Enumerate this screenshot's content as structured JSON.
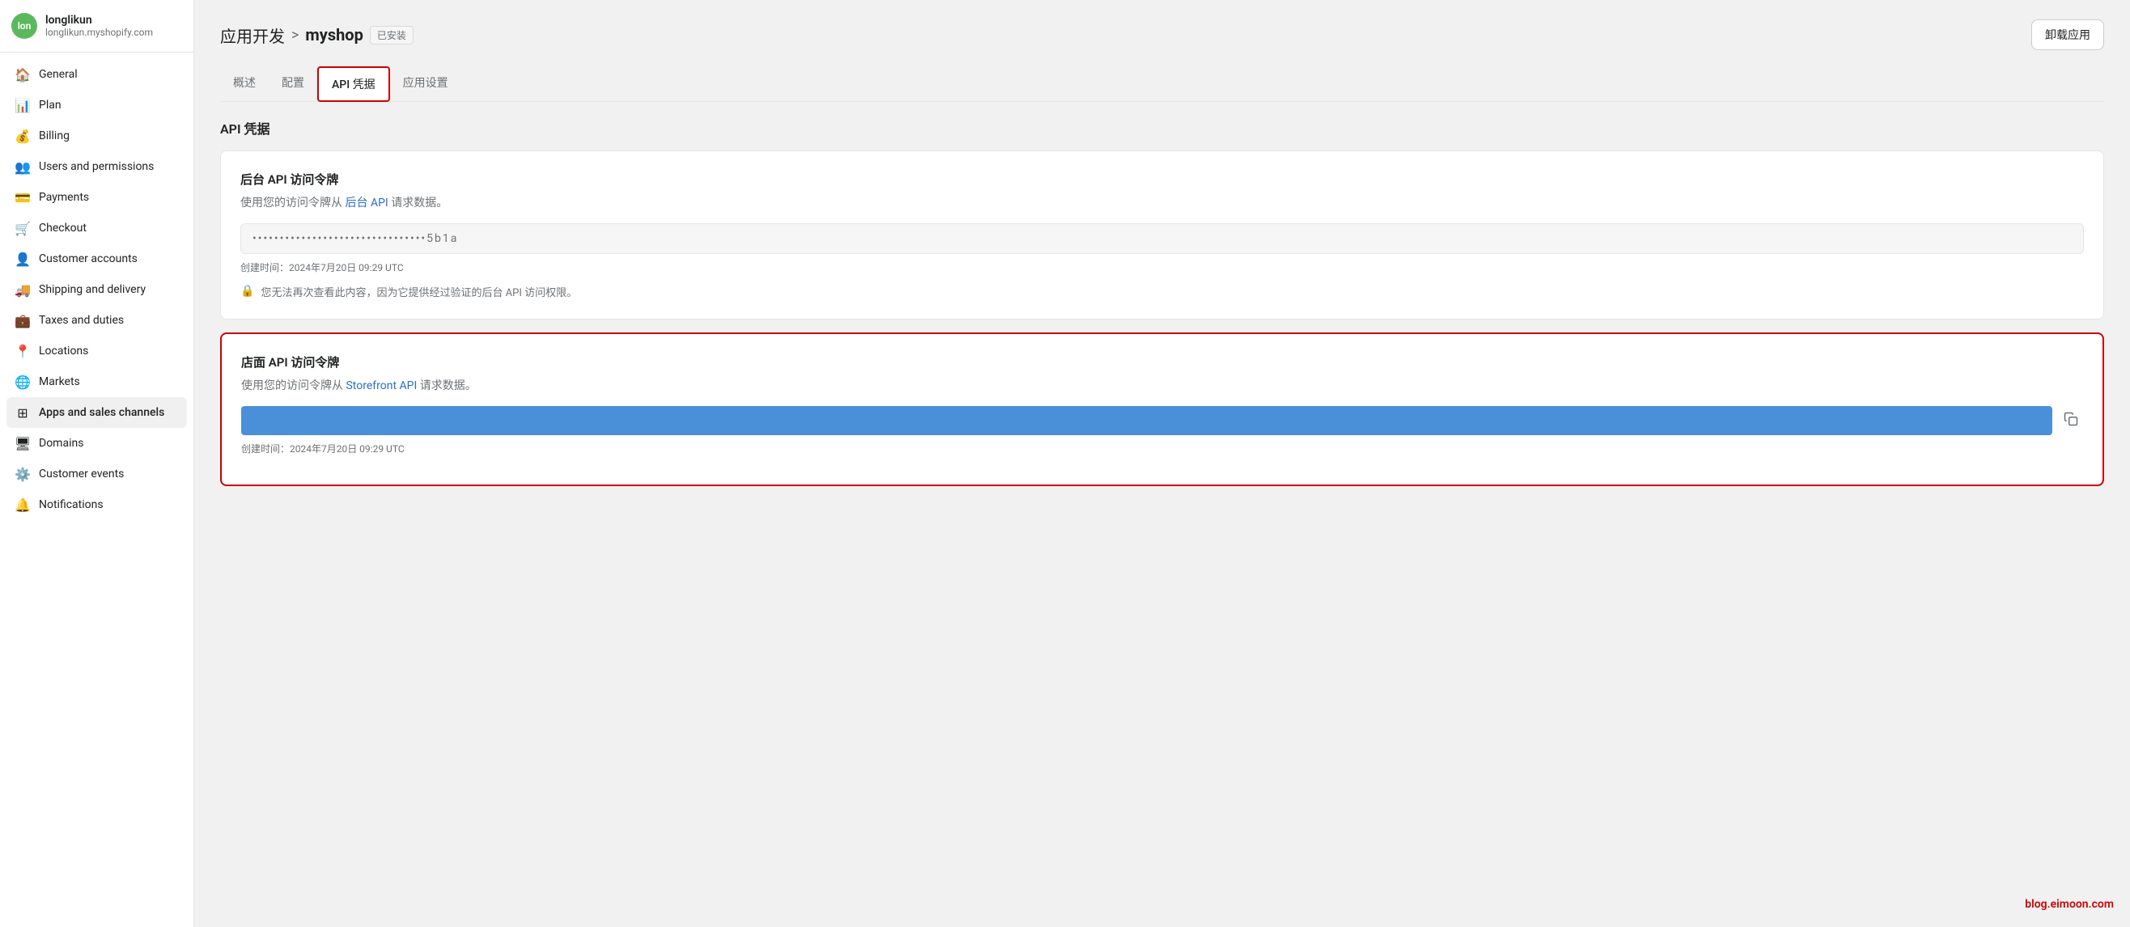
{
  "sidebar": {
    "profile": {
      "initials": "lon",
      "username": "longlikun",
      "domain": "longlikun.myshopify.com"
    },
    "items": [
      {
        "id": "general",
        "label": "General",
        "icon": "🏠",
        "active": false
      },
      {
        "id": "plan",
        "label": "Plan",
        "icon": "📊",
        "active": false
      },
      {
        "id": "billing",
        "label": "Billing",
        "icon": "💰",
        "active": false
      },
      {
        "id": "users",
        "label": "Users and permissions",
        "icon": "👥",
        "active": false
      },
      {
        "id": "payments",
        "label": "Payments",
        "icon": "💳",
        "active": false
      },
      {
        "id": "checkout",
        "label": "Checkout",
        "icon": "🛒",
        "active": false
      },
      {
        "id": "customer-accounts",
        "label": "Customer accounts",
        "icon": "👤",
        "active": false
      },
      {
        "id": "shipping",
        "label": "Shipping and delivery",
        "icon": "🚚",
        "active": false
      },
      {
        "id": "taxes",
        "label": "Taxes and duties",
        "icon": "💼",
        "active": false
      },
      {
        "id": "locations",
        "label": "Locations",
        "icon": "📍",
        "active": false
      },
      {
        "id": "markets",
        "label": "Markets",
        "icon": "🌐",
        "active": false
      },
      {
        "id": "apps",
        "label": "Apps and sales channels",
        "icon": "🔲",
        "active": true
      },
      {
        "id": "domains",
        "label": "Domains",
        "icon": "🖥",
        "active": false
      },
      {
        "id": "customer-events",
        "label": "Customer events",
        "icon": "⚙️",
        "active": false
      },
      {
        "id": "notifications",
        "label": "Notifications",
        "icon": "🔔",
        "active": false
      }
    ]
  },
  "header": {
    "breadcrumb_link": "应用开发",
    "breadcrumb_separator": ">",
    "breadcrumb_current": "myshop",
    "badge": "已安装",
    "uninstall_btn": "卸载应用"
  },
  "tabs": [
    {
      "id": "overview",
      "label": "概述",
      "active": false
    },
    {
      "id": "config",
      "label": "配置",
      "active": false
    },
    {
      "id": "api-credentials",
      "label": "API 凭据",
      "active": true
    },
    {
      "id": "app-settings",
      "label": "应用设置",
      "active": false
    }
  ],
  "page_title": "API 凭据",
  "backend_card": {
    "title": "后台 API 访问令牌",
    "description_prefix": "使用您的访问令牌从",
    "description_link_text": "后台 API",
    "description_suffix": "请求数据。",
    "token_placeholder": "••••••••••••••••••••••••••••••••5b1a",
    "timestamp": "创建时间：2024年7月20日 09:29 UTC",
    "warning_icon": "🔒",
    "warning_text": "您无法再次查看此内容，因为它提供经过验证的后台 API 访问权限。"
  },
  "storefront_card": {
    "title": "店面 API 访问令牌",
    "description_prefix": "使用您的访问令牌从",
    "description_link_text": "Storefront API",
    "description_suffix": "请求数据。",
    "timestamp": "创建时间：2024年7月20日 09:29 UTC"
  },
  "watermark": "blog.eimoon.com"
}
